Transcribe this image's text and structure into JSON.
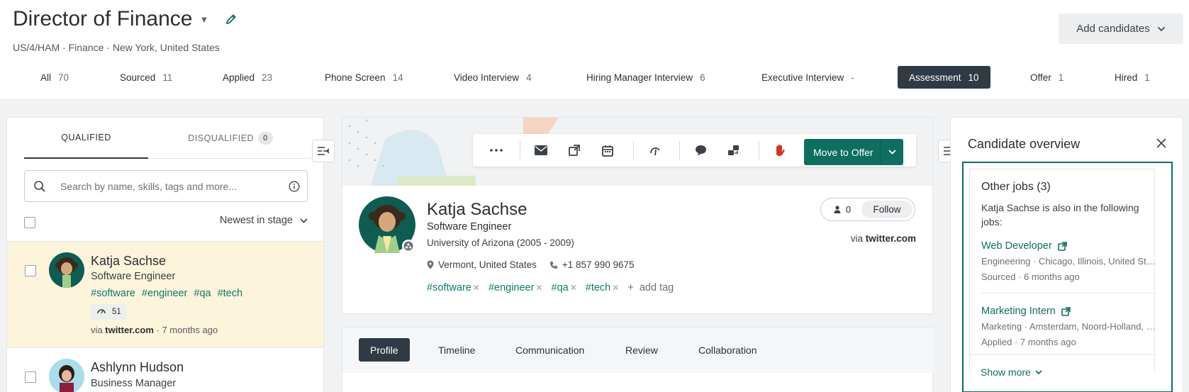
{
  "job": {
    "title": "Director of Finance",
    "subtitle": "US/4/HAM · Finance · New York, United States",
    "add_candidates_label": "Add candidates"
  },
  "stages": [
    {
      "label": "All",
      "count": "70"
    },
    {
      "label": "Sourced",
      "count": "11"
    },
    {
      "label": "Applied",
      "count": "23"
    },
    {
      "label": "Phone Screen",
      "count": "14"
    },
    {
      "label": "Video Interview",
      "count": "4"
    },
    {
      "label": "Hiring Manager Interview",
      "count": "6"
    },
    {
      "label": "Executive Interview",
      "count": "-"
    },
    {
      "label": "Assessment",
      "count": "10"
    },
    {
      "label": "Offer",
      "count": "1"
    },
    {
      "label": "Hired",
      "count": "1"
    }
  ],
  "left": {
    "tab_qualified": "QUALIFIED",
    "tab_disqualified": "DISQUALIFIED",
    "disqualified_count": "0",
    "search_placeholder": "Search by name, skills, tags and more...",
    "sort_label": "Newest in stage",
    "candidates": [
      {
        "name": "Katja Sachse",
        "role": "Software Engineer",
        "tags": [
          "#software",
          "#engineer",
          "#qa",
          "#tech"
        ],
        "score": "51",
        "via_prefix": "via",
        "via_source": "twitter.com",
        "time": "· 7 months ago"
      },
      {
        "name": "Ashlynn Hudson",
        "role": "Business Manager"
      }
    ]
  },
  "profile": {
    "name": "Katja Sachse",
    "role": "Software Engineer",
    "education": "University of Arizona (2005 - 2009)",
    "location": "Vermont, United States",
    "phone": "+1 857 990 9675",
    "tags": [
      "#software",
      "#engineer",
      "#qa",
      "#tech"
    ],
    "add_tag": "add tag",
    "followers": "0",
    "follow_label": "Follow",
    "via_prefix": "via",
    "via_source": "twitter.com",
    "move_label": "Move to Offer",
    "tabs": [
      "Profile",
      "Timeline",
      "Communication",
      "Review",
      "Collaboration"
    ]
  },
  "overview": {
    "title": "Candidate overview",
    "other_jobs_title": "Other jobs (3)",
    "other_jobs_desc": "Katja Sachse is also in the following jobs:",
    "jobs": [
      {
        "title": "Web Developer",
        "meta": "Engineering · Chicago, Illinois, United States",
        "status": "Sourced · 6 months ago"
      },
      {
        "title": "Marketing Intern",
        "meta": "Marketing · Amsterdam, Noord-Holland, Netherlands",
        "status": "Applied · 7 months ago"
      }
    ],
    "show_more": "Show more"
  },
  "colors": {
    "accent": "#0e6e5f",
    "tag": "#0e7a6a",
    "active_stage": "#2f3a44",
    "selected_row": "#fdf4dc"
  }
}
